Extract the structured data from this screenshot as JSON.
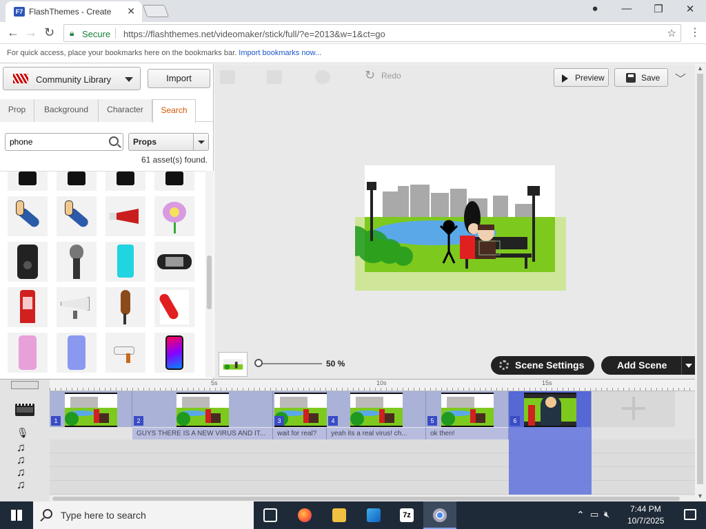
{
  "browser": {
    "tab_title": "FlashThemes - Create",
    "tab_favicon": "F7",
    "address": {
      "security_label": "Secure",
      "url": "https://flashthemes.net/videomaker/stick/full/?e=2013&w=1&ct=go"
    },
    "bookmarks_bar": {
      "message": "For quick access, place your bookmarks here on the bookmarks bar.",
      "link": "Import bookmarks now..."
    }
  },
  "left_panel": {
    "library_label": "Community Library",
    "import_label": "Import",
    "tabs": [
      {
        "label": "Prop",
        "active": false
      },
      {
        "label": "Background",
        "active": false
      },
      {
        "label": "Character",
        "active": false
      },
      {
        "label": "Search",
        "active": true
      }
    ],
    "search": {
      "value": "phone"
    },
    "filter": {
      "value": "Props"
    },
    "result_count": "61 asset(s) found.",
    "assets": [
      {
        "icon": "black-phone-icon"
      },
      {
        "icon": "black-phone-icon"
      },
      {
        "icon": "black-phone-icon"
      },
      {
        "icon": "black-phone-icon"
      },
      {
        "icon": "arm-holding-phone-icon"
      },
      {
        "icon": "arm-holding-phone-icon"
      },
      {
        "icon": "megaphone-icon"
      },
      {
        "icon": "flower-with-phone-icon"
      },
      {
        "icon": "black-smartphone-icon"
      },
      {
        "icon": "microphone-icon"
      },
      {
        "icon": "cyan-phone-icon"
      },
      {
        "icon": "handheld-console-icon"
      },
      {
        "icon": "phone-booth-icon"
      },
      {
        "icon": "white-megaphone-icon"
      },
      {
        "icon": "brown-phone-icon"
      },
      {
        "icon": "red-handset-icon"
      },
      {
        "icon": "pink-smartphone-icon"
      },
      {
        "icon": "blue-smartphone-icon"
      },
      {
        "icon": "hairdryer-icon"
      },
      {
        "icon": "iphone-x-icon"
      }
    ]
  },
  "toolbar": {
    "redo_label": "Redo",
    "preview_label": "Preview",
    "save_label": "Save"
  },
  "zoom": {
    "value": "50 %",
    "level_percent": 50
  },
  "scene_buttons": {
    "scene_settings": "Scene Settings",
    "add_scene": "Add Scene"
  },
  "timeline": {
    "ruler_ticks": [
      "5s",
      "10s",
      "15s"
    ],
    "scenes": [
      {
        "number": "1",
        "dialogue": "",
        "selected": false
      },
      {
        "number": "2",
        "dialogue": "GUYS THERE IS A NEW VIRUS AND IT...",
        "selected": false
      },
      {
        "number": "3",
        "dialogue": "wait for real?",
        "selected": false
      },
      {
        "number": "4",
        "dialogue": "yeah its a real virus! ch...",
        "selected": false
      },
      {
        "number": "5",
        "dialogue": "ok then!",
        "selected": false
      },
      {
        "number": "6",
        "dialogue": "",
        "selected": true
      }
    ]
  },
  "taskbar": {
    "search_placeholder": "Type here to search",
    "time": "7:44 PM",
    "date": "10/7/2025"
  },
  "colors": {
    "accent_search_tab": "#d45500",
    "scene_block": "#aab3d7",
    "scene_selected": "#5568d6",
    "taskbar": "#1f2a38"
  }
}
